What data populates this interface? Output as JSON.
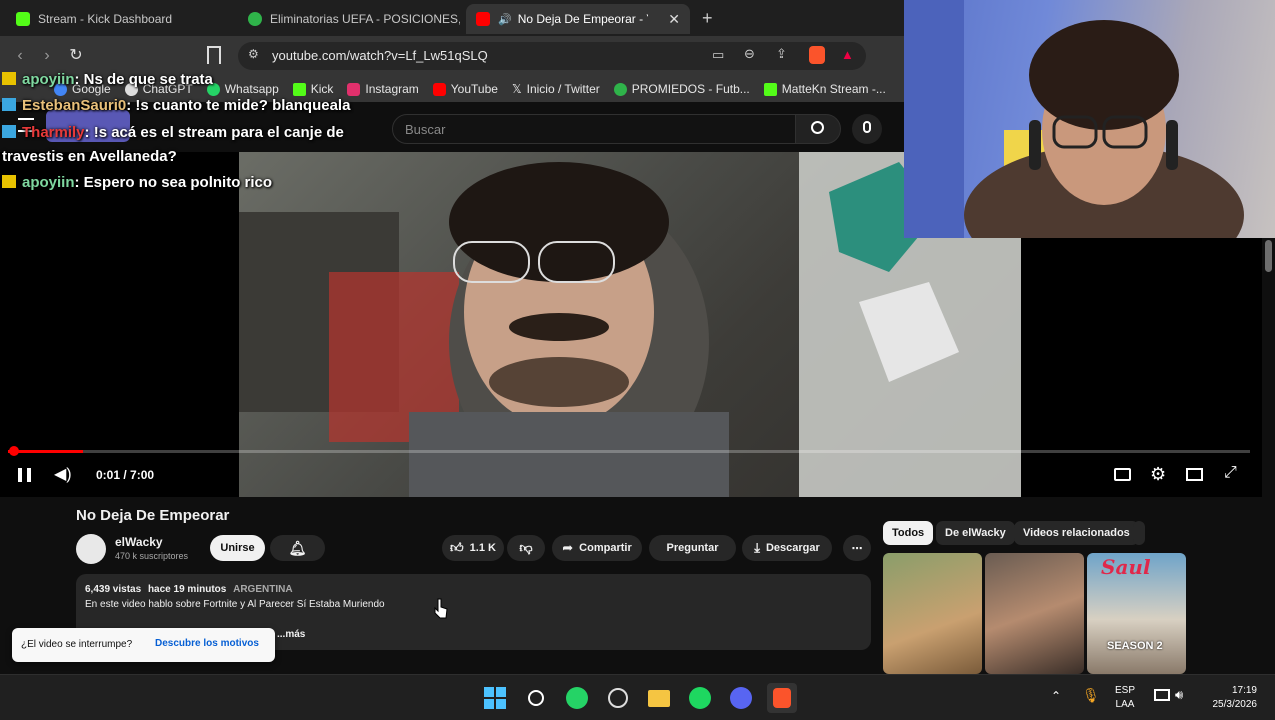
{
  "browser": {
    "tabs": [
      {
        "label": "Stream - Kick Dashboard",
        "color": "#53fc18"
      },
      {
        "label": "Eliminatorias UEFA - POSICIONES, RE",
        "color": "#2fb34a"
      },
      {
        "label": "No Deja De Empeorar - YouTube",
        "color": "#ff0000"
      }
    ],
    "new_tab": "+",
    "url": "youtube.com/watch?v=Lf_Lw51qSLQ",
    "bookmarks": [
      {
        "label": "Google",
        "color": "#4285f4"
      },
      {
        "label": "ChatGPT",
        "color": "#dddddd"
      },
      {
        "label": "Whatsapp",
        "color": "#25d366"
      },
      {
        "label": "Kick",
        "color": "#53fc18"
      },
      {
        "label": "Instagram",
        "color": "#e1306c"
      },
      {
        "label": "YouTube",
        "color": "#ff0000"
      },
      {
        "label": "Inicio / Twitter",
        "color": "#ffffff"
      },
      {
        "label": "PROMIEDOS - Futb...",
        "color": "#2fb34a"
      },
      {
        "label": "MatteKn Stream -...",
        "color": "#53fc18"
      }
    ]
  },
  "youtube": {
    "search_placeholder": "Buscar",
    "player": {
      "time": "0:01 / 7:00",
      "progress_fraction": 0.0024
    },
    "video": {
      "title": "No Deja De Empeorar",
      "channel": "elWacky",
      "subscribers": "470 k suscriptores",
      "join_label": "Unirse",
      "likes": "1.1 K",
      "share_label": "Compartir",
      "ask_label": "Preguntar",
      "download_label": "Descargar",
      "views": "6,439 vistas",
      "posted": "hace 19 minutos",
      "country": "ARGENTINA",
      "description": "En este video hablo sobre Fortnite y Al Parecer Sí Estaba Muriendo",
      "more": "...más"
    },
    "toast": {
      "question": "¿El video se interrumpe?",
      "link": "Descubre los motivos"
    },
    "chips": [
      "Todos",
      "De elWacky",
      "Videos relacionados"
    ],
    "thumb_caption": "SEASON 2",
    "thumb_brand": "Saul"
  },
  "chat": [
    {
      "user": "apoyiin",
      "user_color": "#7fd8a0",
      "message": ": Ns de que se trata"
    },
    {
      "user": "EstebanSauri0",
      "user_color": "#e8c07a",
      "message": ": !s cuanto te mide? blanqueala"
    },
    {
      "user": "Tharmily",
      "user_color": "#e83a3a",
      "message": ": !s acá es el stream para el canje de"
    },
    {
      "user": "",
      "user_color": "#ffffff",
      "message": "travestis en Avellaneda?"
    },
    {
      "user": "apoyiin",
      "user_color": "#7fd8a0",
      "message": ": Espero no sea polnito rico"
    }
  ],
  "taskbar": {
    "lang_top": "ESP",
    "lang_bottom": "LAA",
    "time": "17:19",
    "date": "25/3/2026"
  }
}
